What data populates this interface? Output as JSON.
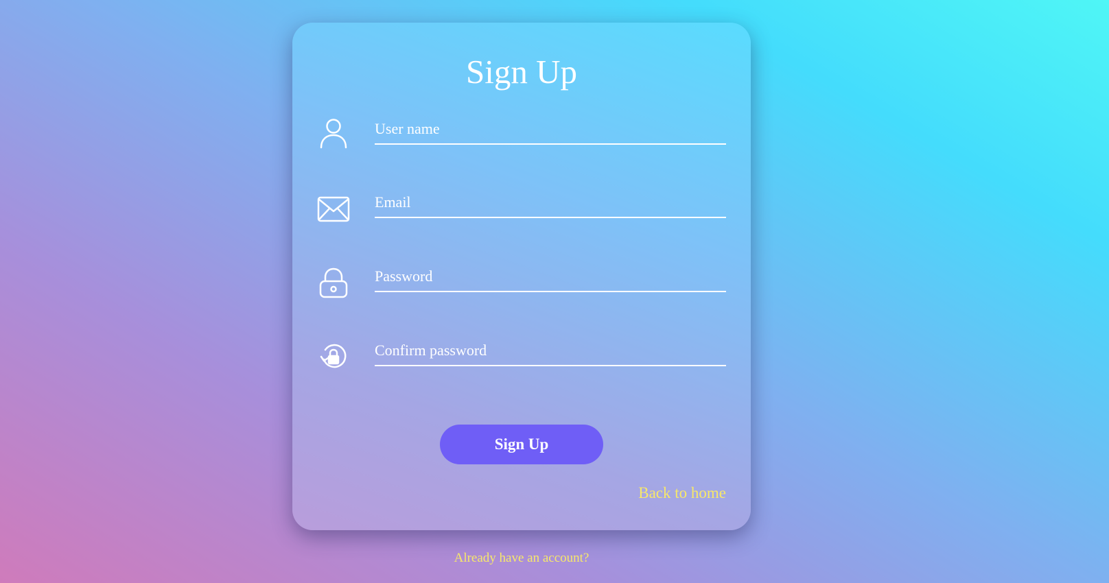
{
  "form": {
    "title": "Sign Up",
    "fields": [
      {
        "icon": "user-icon",
        "placeholder": "User name",
        "value": ""
      },
      {
        "icon": "envelope-icon",
        "placeholder": "Email",
        "value": ""
      },
      {
        "icon": "lock-icon",
        "placeholder": "Password",
        "value": ""
      },
      {
        "icon": "lock-reset-icon",
        "placeholder": "Confirm password",
        "value": ""
      }
    ],
    "submit_label": "Sign Up",
    "back_link": "Back to home"
  },
  "footer": {
    "account_link": "Already have an account?"
  },
  "colors": {
    "button": "#6f5ef6",
    "link": "#f7e86a",
    "text": "#ffffff"
  }
}
